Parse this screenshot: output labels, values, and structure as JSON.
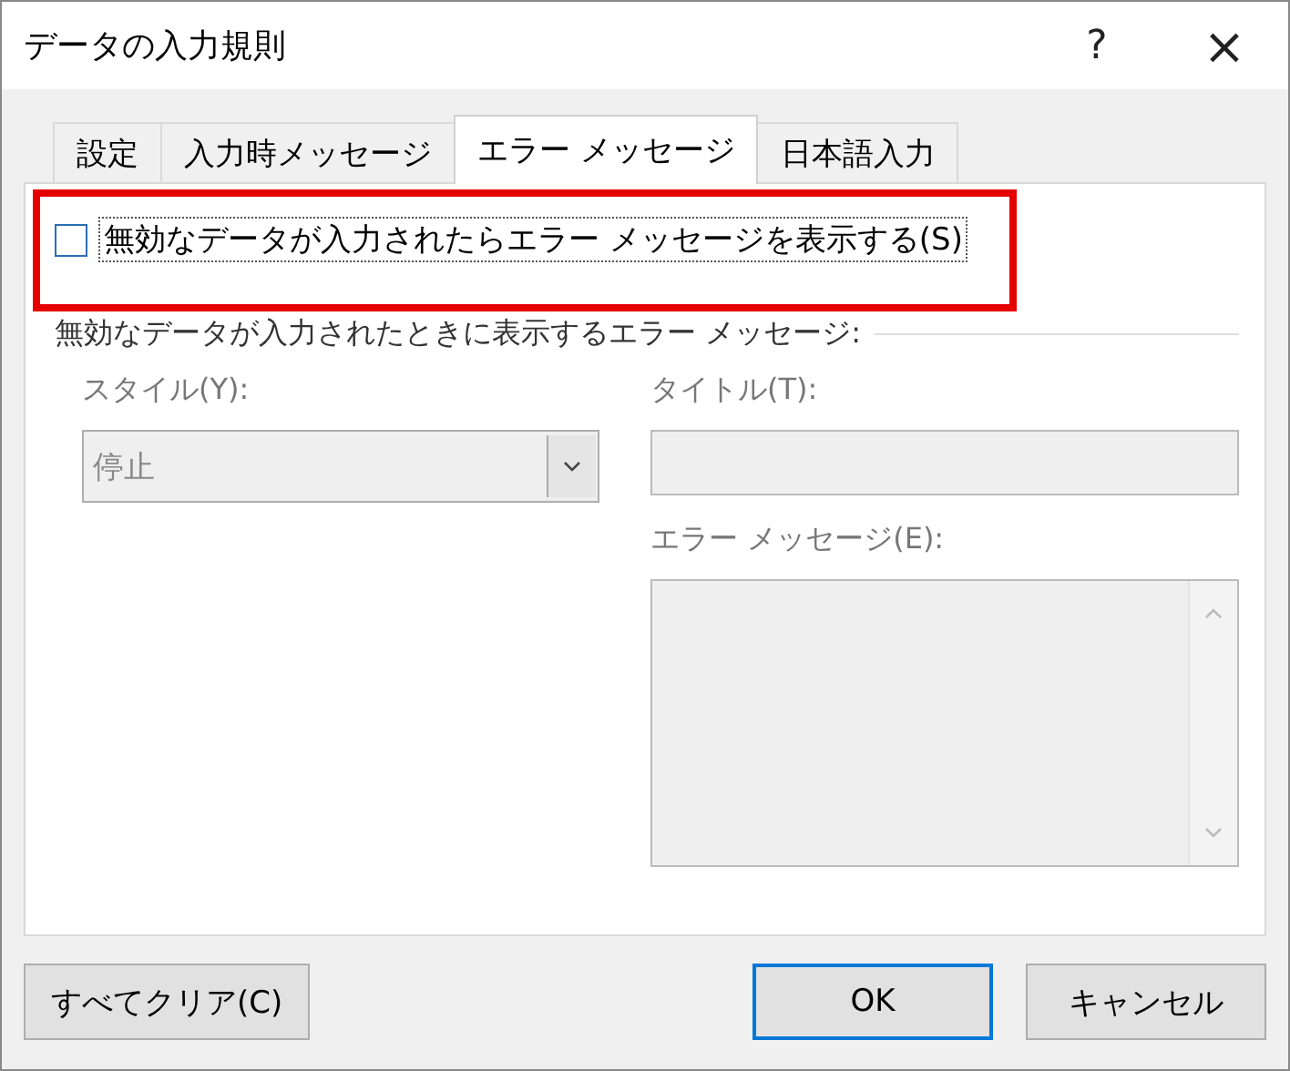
{
  "window": {
    "title": "データの入力規則",
    "help": "?",
    "close": "×"
  },
  "tabs": [
    {
      "label": "設定",
      "selected": false
    },
    {
      "label": "入力時メッセージ",
      "selected": false
    },
    {
      "label": "エラー メッセージ",
      "selected": true
    },
    {
      "label": "日本語入力",
      "selected": false
    }
  ],
  "show_error": {
    "label": "無効なデータが入力されたらエラー メッセージを表示する(S)",
    "checked": false,
    "highlighted": true
  },
  "group_label": "無効なデータが入力されたときに表示するエラー メッセージ:",
  "style": {
    "label": "スタイル(Y):",
    "value": "停止",
    "disabled": true
  },
  "title": {
    "label": "タイトル(T):",
    "disabled": true
  },
  "message": {
    "label": "エラー メッセージ(E):",
    "disabled": true
  },
  "buttons": [
    {
      "label": "すべてクリア(C)",
      "kind": "clear",
      "default": false
    },
    {
      "label": "OK",
      "kind": "ok",
      "default": true
    },
    {
      "label": "キャンセル",
      "kind": "cancel",
      "default": false
    }
  ]
}
